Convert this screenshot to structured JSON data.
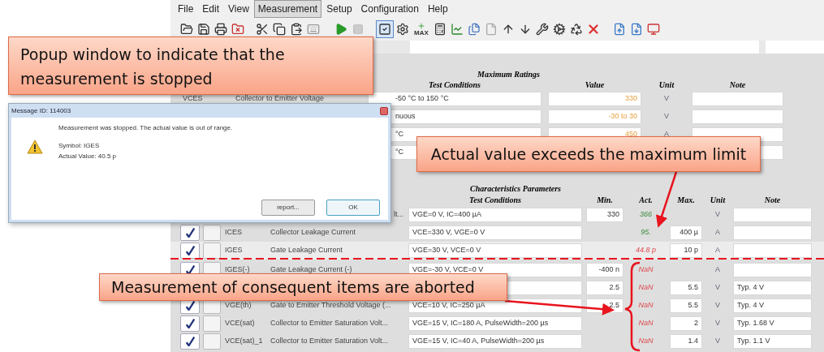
{
  "menu": [
    {
      "label": "File",
      "selected": false
    },
    {
      "label": "Edit",
      "selected": false
    },
    {
      "label": "View",
      "selected": false
    },
    {
      "label": "Measurement",
      "selected": true
    },
    {
      "label": "Setup",
      "selected": false
    },
    {
      "label": "Configuration",
      "selected": false
    },
    {
      "label": "Help",
      "selected": false
    }
  ],
  "toolbar": {
    "max_label": "MAX",
    "check_tool_pressed": true
  },
  "max_ratings": {
    "title": "Maximum Ratings",
    "headers": [
      "Test Conditions",
      "Value",
      "Unit",
      "Note"
    ],
    "rows": [
      {
        "symbol": "VCES",
        "name": "Collector to Emitter Voltage",
        "condition": "-50 °C to 150 °C",
        "value": "330",
        "unit": "V"
      },
      {
        "symbol": "",
        "name": "",
        "condition": "nuous",
        "value": "-30  to 30",
        "unit": "V"
      },
      {
        "symbol": "",
        "name": "",
        "condition": "°C",
        "value": "450",
        "unit": "A"
      },
      {
        "symbol": "",
        "name": "",
        "condition": "°C",
        "value": "",
        "unit": ""
      }
    ]
  },
  "characteristics": {
    "title": "Characteristics Parameters",
    "headers": [
      "Test Conditions",
      "Min.",
      "Act.",
      "Max.",
      "Unit",
      "Note"
    ],
    "rows": [
      {
        "selected": false,
        "symbol": "",
        "name": "lt...",
        "name_clipped": true,
        "condition": "VGE=0 V, IC=400 µA",
        "min": "330",
        "act": "366",
        "kind": "pass",
        "max": "",
        "unit": "V",
        "note": ""
      },
      {
        "checked": true,
        "selected": false,
        "symbol": "ICES",
        "name": "Collector Leakage Current",
        "name_clipped": false,
        "condition": "VCE=330 V, VGE=0 V",
        "min": "",
        "act": "95.",
        "kind": "pass",
        "max": "400 µ",
        "unit": "A",
        "note": ""
      },
      {
        "checked": true,
        "selected": true,
        "symbol": "IGES",
        "name": "Gate Leakage Current",
        "name_clipped": false,
        "condition": "VGE=30 V, VCE=0 V",
        "min": "",
        "act": "44.8 p",
        "kind": "fail",
        "max": "10 p",
        "unit": "A",
        "note": ""
      },
      {
        "checked": true,
        "selected": false,
        "symbol": "IGES(-)",
        "name": "Gate Leakage Current (-)",
        "name_clipped": false,
        "condition": "VGE=-30 V, VCE=0 V",
        "min": "-400 n",
        "act": "NaN",
        "kind": "fail",
        "max": "",
        "unit": "A",
        "note": ""
      },
      {
        "selected": false,
        "symbol": "",
        "name": "",
        "condition": "",
        "min": "2.5",
        "act": "NaN",
        "kind": "fail",
        "max": "5.5",
        "unit": "V",
        "note": "Typ. 4 V"
      },
      {
        "checked": true,
        "selected": false,
        "symbol": "VGE(th)",
        "name": "Gate to Emitter Threshold Voltage (...",
        "name_clipped": false,
        "condition": "VCE=10 V, IC=250 µA",
        "min": "2.5",
        "act": "NaN",
        "kind": "fail",
        "max": "5.5",
        "unit": "V",
        "note": "Typ. 4 V"
      },
      {
        "checked": true,
        "selected": false,
        "symbol": "VCE(sat)",
        "name": "Collector to Emitter Saturation Volt...",
        "name_clipped": false,
        "condition": "VGE=15 V, IC=180 A, PulseWidth=200 µs",
        "min": "",
        "act": "NaN",
        "kind": "fail",
        "max": "2",
        "unit": "V",
        "note": "Typ. 1.68 V"
      },
      {
        "checked": true,
        "selected": false,
        "symbol": "VCE(sat)_1",
        "name": "Collector to Emitter Saturation Volt...",
        "name_clipped": false,
        "condition": "VGE=15 V, IC=40 A, PulseWidth=200 µs",
        "min": "",
        "act": "NaN",
        "kind": "fail",
        "max": "1.4",
        "unit": "V",
        "note": "Typ. 1.1 V"
      }
    ]
  },
  "dialog": {
    "title": "Message ID: 114003",
    "message": "Measurement was stopped. The actual value is out of range.",
    "symbol_line": "Symbol: IGES",
    "value_line": "Actual Value: 40.5 p",
    "buttons": [
      {
        "label": "report...",
        "default": false
      },
      {
        "label": "OK",
        "default": true
      }
    ]
  },
  "annotations": [
    {
      "text": "Popup window to indicate that the measurement is stopped"
    },
    {
      "text": "Actual value exceeds the maximum limit"
    },
    {
      "text": "Measurement of consequent items are aborted"
    }
  ]
}
